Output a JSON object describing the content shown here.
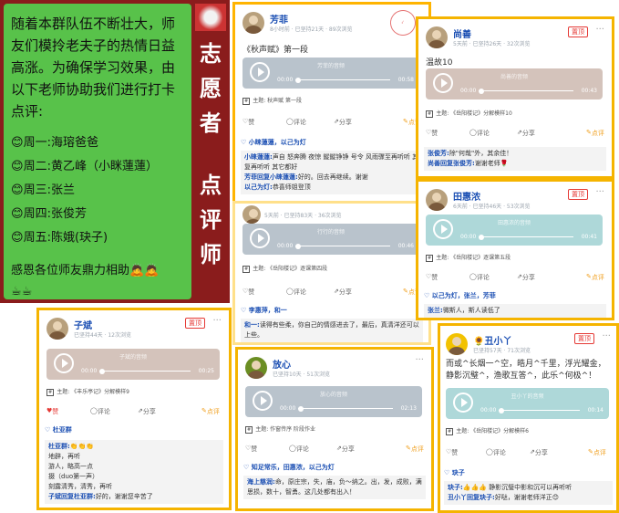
{
  "notice": {
    "lines": [
      "随着本群队伍不断壮大，师",
      "友们模拎老夫子的热情日益",
      "高涨。为确保学习效果，由",
      "以下老师协助我们进行打卡",
      "点评:"
    ],
    "schedule": [
      "周一:海瑢爸爸",
      "周二:黄乙峰（小眯蓮蓮）",
      "周三:张兰",
      "周四:张俊芳",
      "周五:陈娥(玦子)"
    ],
    "thanks": "感恩各位师友鼎力相助",
    "banner": [
      "志",
      "愿",
      "者",
      "点",
      "评",
      "师"
    ]
  },
  "posts": [
    {
      "user": "芳菲",
      "meta": "8小时前 · 已坚持21天 · 89次浏览",
      "text": "《秋声赋》第一段",
      "audio_title": "芳菲的音频",
      "time_start": "00:00",
      "time_end": "00:58",
      "topic": "主题: 秋声赋 第一段",
      "like": "赞",
      "comment": "评论",
      "share": "分享",
      "review": "点评",
      "likes": "小睐蓮蓮，以己为灯",
      "comments": [
        [
          "小睐蓮蓮:",
          "声自 怒奔腾 夜惊 鏦鏦铮铮 号令 风雨骤至再听听 其它都好"
        ],
        [
          "芳菲回复小睐蓮蓮:",
          "好的。回去再继续。谢谢"
        ],
        [
          "以己为灯:",
          "恭喜师姐登顶"
        ]
      ]
    },
    {
      "user": "尚善",
      "meta": "5天前 · 已坚持26天 · 32次浏览",
      "tag": "置顶",
      "text": "温故10",
      "audio_title": "尚善的音频",
      "time_start": "00:00",
      "time_end": "00:43",
      "topic": "主题: 《岳阳楼记》分解模样10",
      "like": "赞",
      "comment": "评论",
      "share": "分享",
      "review": "点评",
      "comments": [
        [
          "张俊芳:",
          "除\"何哉\"外，其余佳！"
        ],
        [
          "尚善回复张俊芳:",
          "谢谢老师🌹"
        ]
      ]
    },
    {
      "user": "",
      "meta": "5天前 · 已坚持83天 · 36次浏览",
      "audio_title": "行行的音频",
      "time_start": "00:00",
      "time_end": "00:46",
      "topic": "主题: 《岳阳楼记》逐课第四段",
      "like": "赞",
      "comment": "评论",
      "share": "分享",
      "review": "点评",
      "likes": "李惠萍，和一",
      "comments": [
        [
          "和一:",
          "读得有些柔，你自己的情感进去了，最后，真清洋还可以上些。"
        ]
      ]
    },
    {
      "user": "田惠浓",
      "meta": "6天前 · 已坚持46天 · 53次浏览",
      "tag": "置顶",
      "audio_title": "田惠浓的音频",
      "time_start": "00:00",
      "time_end": "00:41",
      "topic": "主题: 《岳阳楼记》逐课第五段",
      "like": "赞",
      "comment": "评论",
      "share": "分享",
      "review": "点评",
      "likes": "以己为灯，张兰，芳菲",
      "comments": [
        [
          "张兰:",
          "微斯人，斯人读低了"
        ]
      ]
    },
    {
      "user": "子斌",
      "meta": "已坚持44天 · 12次浏览",
      "tag": "置顶",
      "audio_title": "子斌的音频",
      "time_start": "00:00",
      "time_end": "00:25",
      "topic": "主题: 《丰乐亭记》分解模样9",
      "like": "赞",
      "comment": "评论",
      "share": "分享",
      "review": "点评",
      "likes": "杜亚群",
      "comments": [
        [
          "杜亚群:",
          "👏👏👏"
        ],
        [
          "",
          "地辟，再听"
        ],
        [
          "",
          "游人，略高一点"
        ],
        [
          "",
          "掇（duo第一声）"
        ],
        [
          "",
          "刻露清秀，清秀，再听"
        ],
        [
          "子斌回复杜亚群:",
          "好的，谢谢您辛苦了"
        ]
      ]
    },
    {
      "user": "放心",
      "meta": "已坚持10天 · 51次浏览",
      "audio_title": "放心的音频",
      "time_start": "00:00",
      "time_end": "02:13",
      "topic": "主题: 作窗传序 阶段作业",
      "like": "赞",
      "comment": "评论",
      "share": "分享",
      "review": "点评",
      "likes": "知足常乐，田惠浓，以己为灯",
      "comments": [
        [
          "海上慈润:",
          "命，原庄宗，失，庙，负～纳之。出，发，成败，满思损，数十，智勇。这几处都有出入！"
        ]
      ]
    },
    {
      "user": "丑小丫",
      "meta": "已坚持57天 · 71次浏览",
      "tag": "置顶",
      "text_lines": [
        "而或^长烟一^空，皓月^千里，浮光耀金，",
        "静影沉璧^，渔歌互答^，此乐^何极^！"
      ],
      "audio_title": "丑小丫的音频",
      "time_start": "00:00",
      "time_end": "00:14",
      "topic": "主题: 《岳阳楼记》分解模样6",
      "like": "赞",
      "comment": "评论",
      "share": "分享",
      "review": "点评",
      "likes": "玦子",
      "comments": [
        [
          "玦子:",
          "👍👍👍 静影沉璧中影和沉可以再听听"
        ],
        [
          "丑小丫回复玦子:",
          "好哒，谢谢老师洋正😊"
        ]
      ]
    }
  ]
}
